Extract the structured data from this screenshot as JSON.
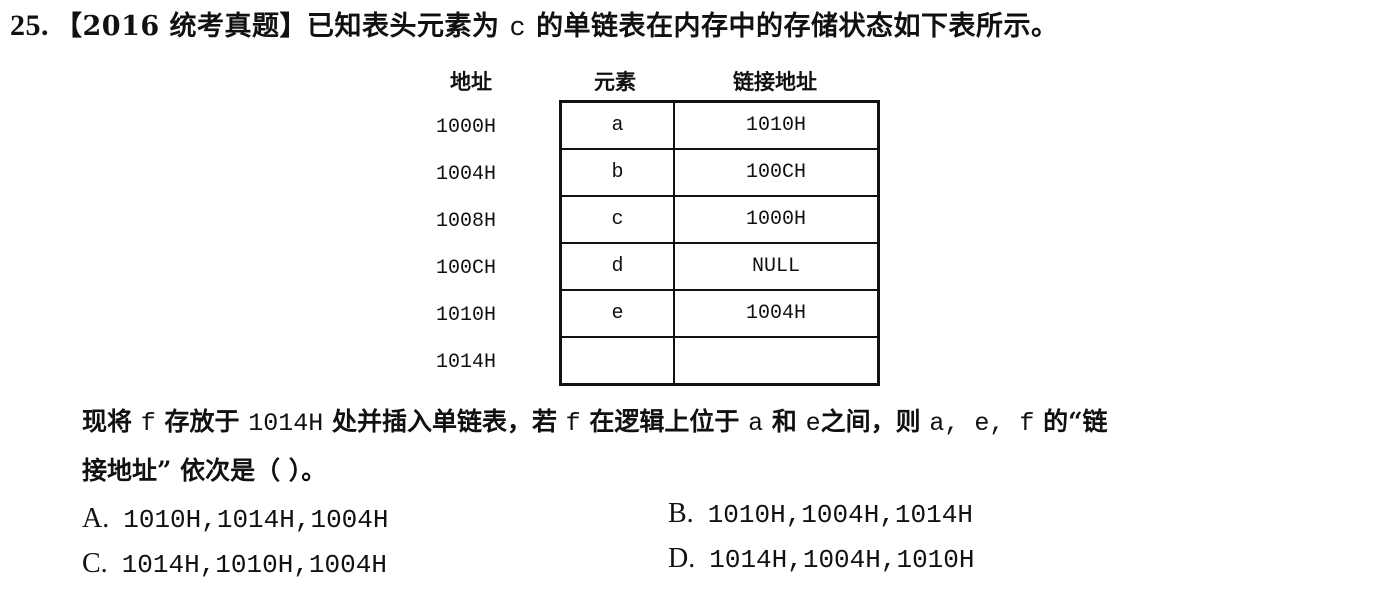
{
  "question": {
    "number": "25.",
    "title_prefix": "【2016 统考真题】已知表头元素为",
    "head_element": "c",
    "title_suffix": "的单链表在内存中的存储状态如下表所示。"
  },
  "table": {
    "headers": {
      "address": "地址",
      "element": "元素",
      "link": "链接地址"
    },
    "rows": [
      {
        "address": "1000H",
        "element": "a",
        "link": "1010H"
      },
      {
        "address": "1004H",
        "element": "b",
        "link": "100CH"
      },
      {
        "address": "1008H",
        "element": "c",
        "link": "1000H"
      },
      {
        "address": "100CH",
        "element": "d",
        "link": "NULL"
      },
      {
        "address": "1010H",
        "element": "e",
        "link": "1004H"
      },
      {
        "address": "1014H",
        "element": "",
        "link": ""
      }
    ]
  },
  "body": {
    "line1_a": "现将",
    "f1": "f",
    "line1_b": "存放于",
    "addr": "1014H",
    "line1_c": "处并插入单链表，若",
    "f2": "f",
    "line1_d": "在逻辑上位于",
    "a1": "a",
    "line1_e": "和",
    "e1": "e",
    "line1_f": "之间，则",
    "list": "a, e, f",
    "line1_g": "的“链",
    "line2": "接地址” 依次是（    ）。"
  },
  "options": [
    {
      "letter": "A.",
      "value": "1010H,1014H,1004H"
    },
    {
      "letter": "B.",
      "value": "1010H,1004H,1014H"
    },
    {
      "letter": "C.",
      "value": "1014H,1010H,1004H"
    },
    {
      "letter": "D.",
      "value": "1014H,1004H,1010H"
    }
  ]
}
